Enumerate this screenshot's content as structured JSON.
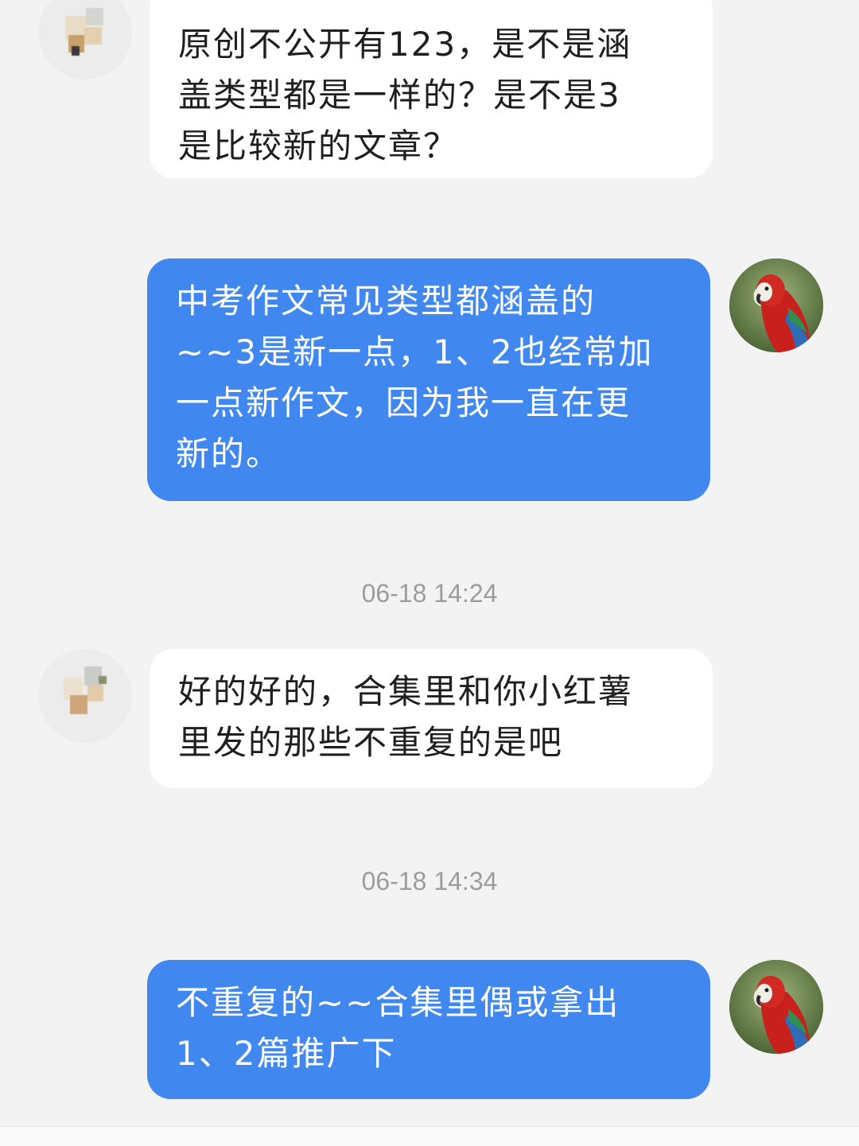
{
  "conversation": {
    "messages": [
      {
        "id": "m1",
        "sender": "contact",
        "text": "原创不公开有123，是不是涵\n盖类型都是一样的？是不是3\n是比较新的文章？"
      },
      {
        "id": "m2",
        "sender": "me",
        "text": "中考作文常见类型都涵盖的\n~~3是新一点，1、2也经常加\n一点新作文，因为我一直在更\n新的。"
      },
      {
        "id": "m3",
        "sender": "contact",
        "text": "好的好的，合集里和你小红薯\n里发的那些不重复的是吧"
      },
      {
        "id": "m4",
        "sender": "me",
        "text": "不重复的~~合集里偶或拿出\n1、2篇推广下"
      }
    ],
    "timestamps": [
      "06-18 14:24",
      "06-18 14:34"
    ]
  },
  "avatars": {
    "contact": "blurred-avatar",
    "me": "parrot-avatar"
  },
  "colors": {
    "background": "#f3f3f3",
    "incoming_bubble": "#ffffff",
    "outgoing_bubble": "#4088f0",
    "timestamp_text": "#9c9c9c"
  }
}
